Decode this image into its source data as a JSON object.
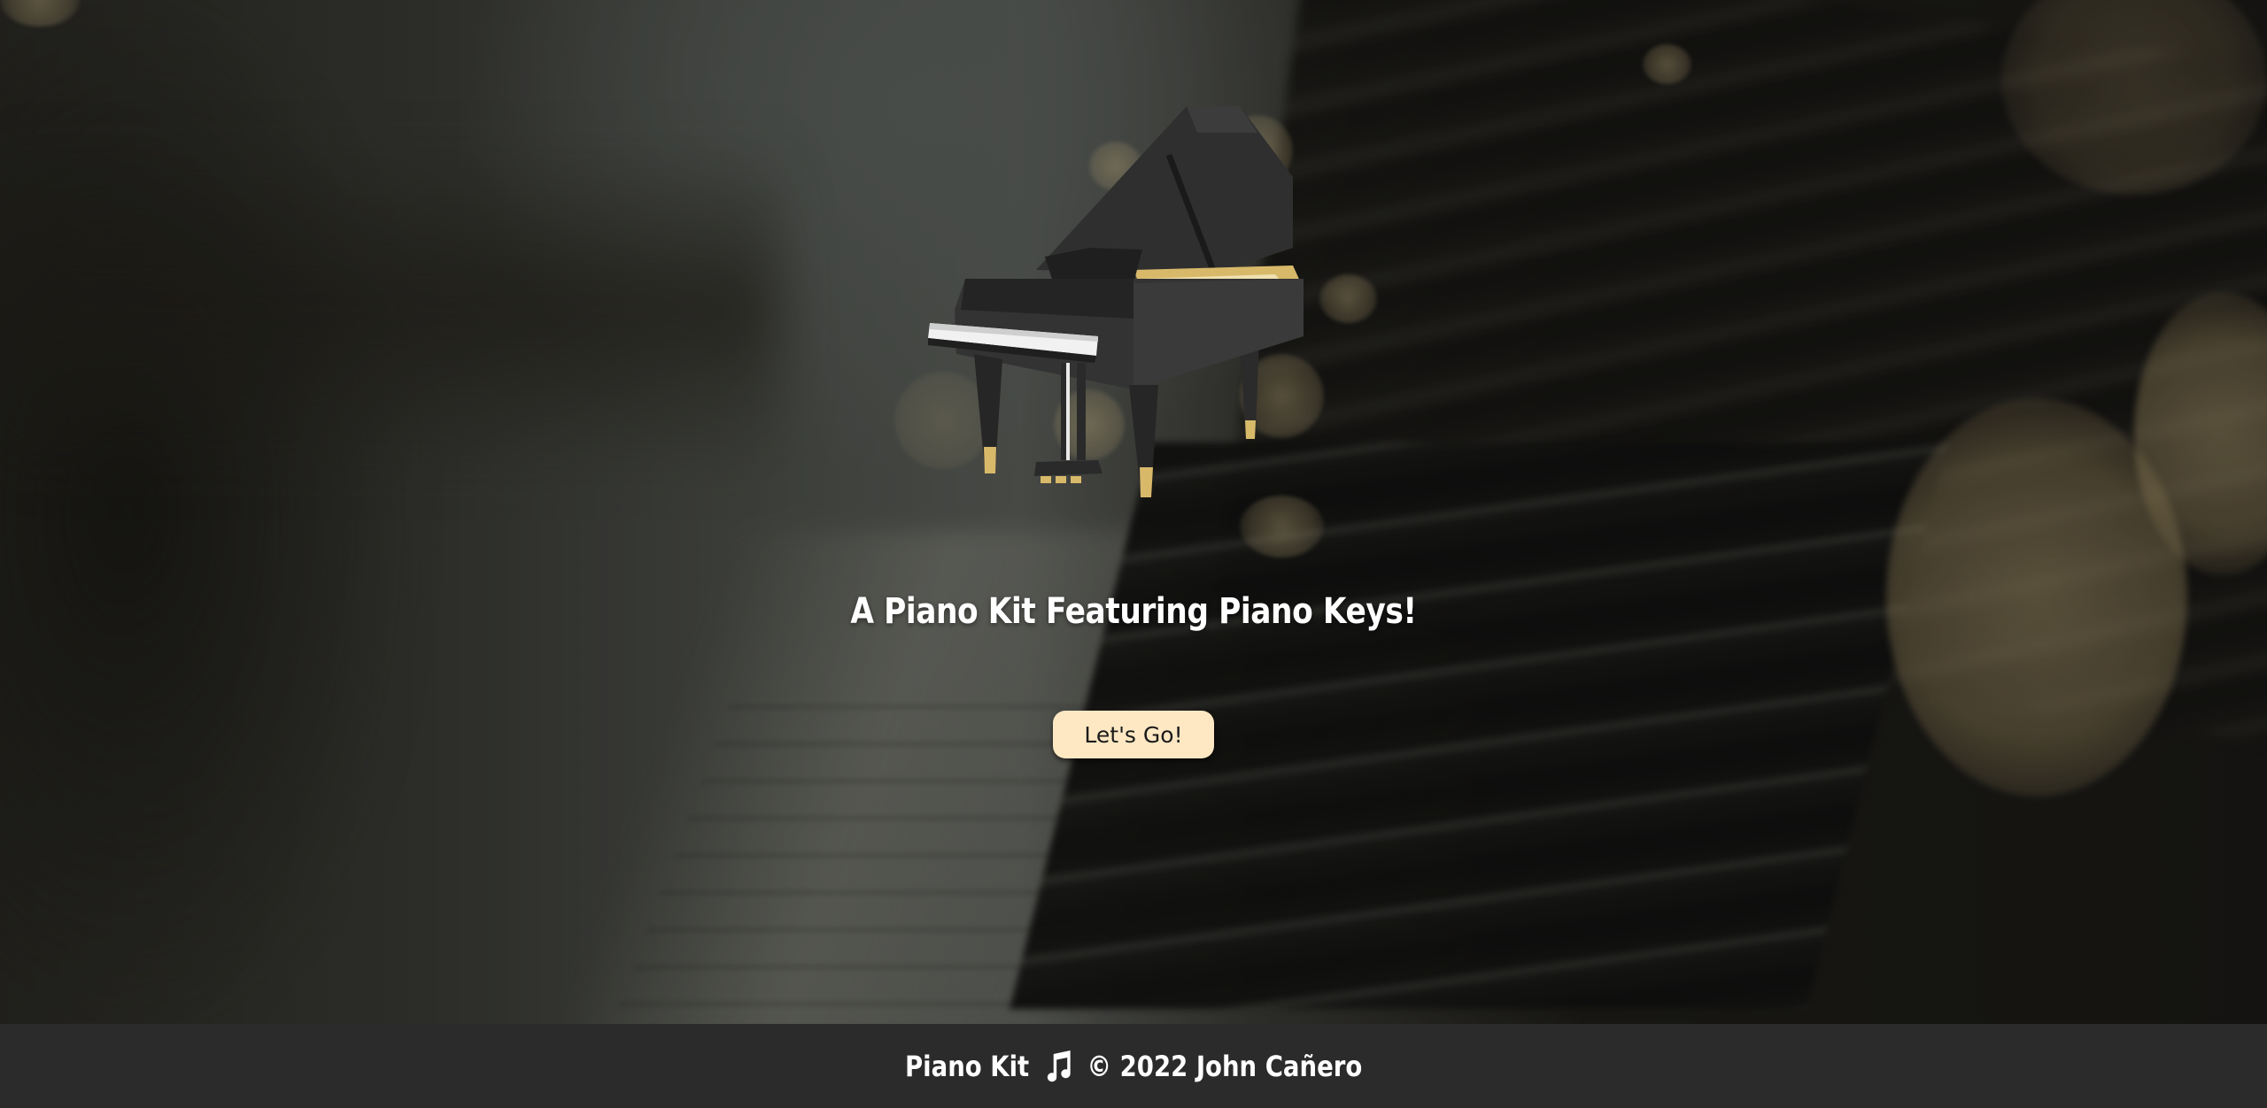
{
  "hero": {
    "headline": "A Piano Kit Featuring Piano Keys!",
    "cta_label": "Let's Go!"
  },
  "logo": {
    "icon": "grand-piano-icon",
    "body_color": "#2f2f2f",
    "accent_color": "#d8b96a"
  },
  "footer": {
    "brand": "Piano Kit",
    "icon": "music-note-icon",
    "copyright": "© 2022 John Cañero"
  },
  "colors": {
    "button_bg": "#fde8c3",
    "footer_bg": "#2b2b2b",
    "headline_text": "#ffffff"
  }
}
